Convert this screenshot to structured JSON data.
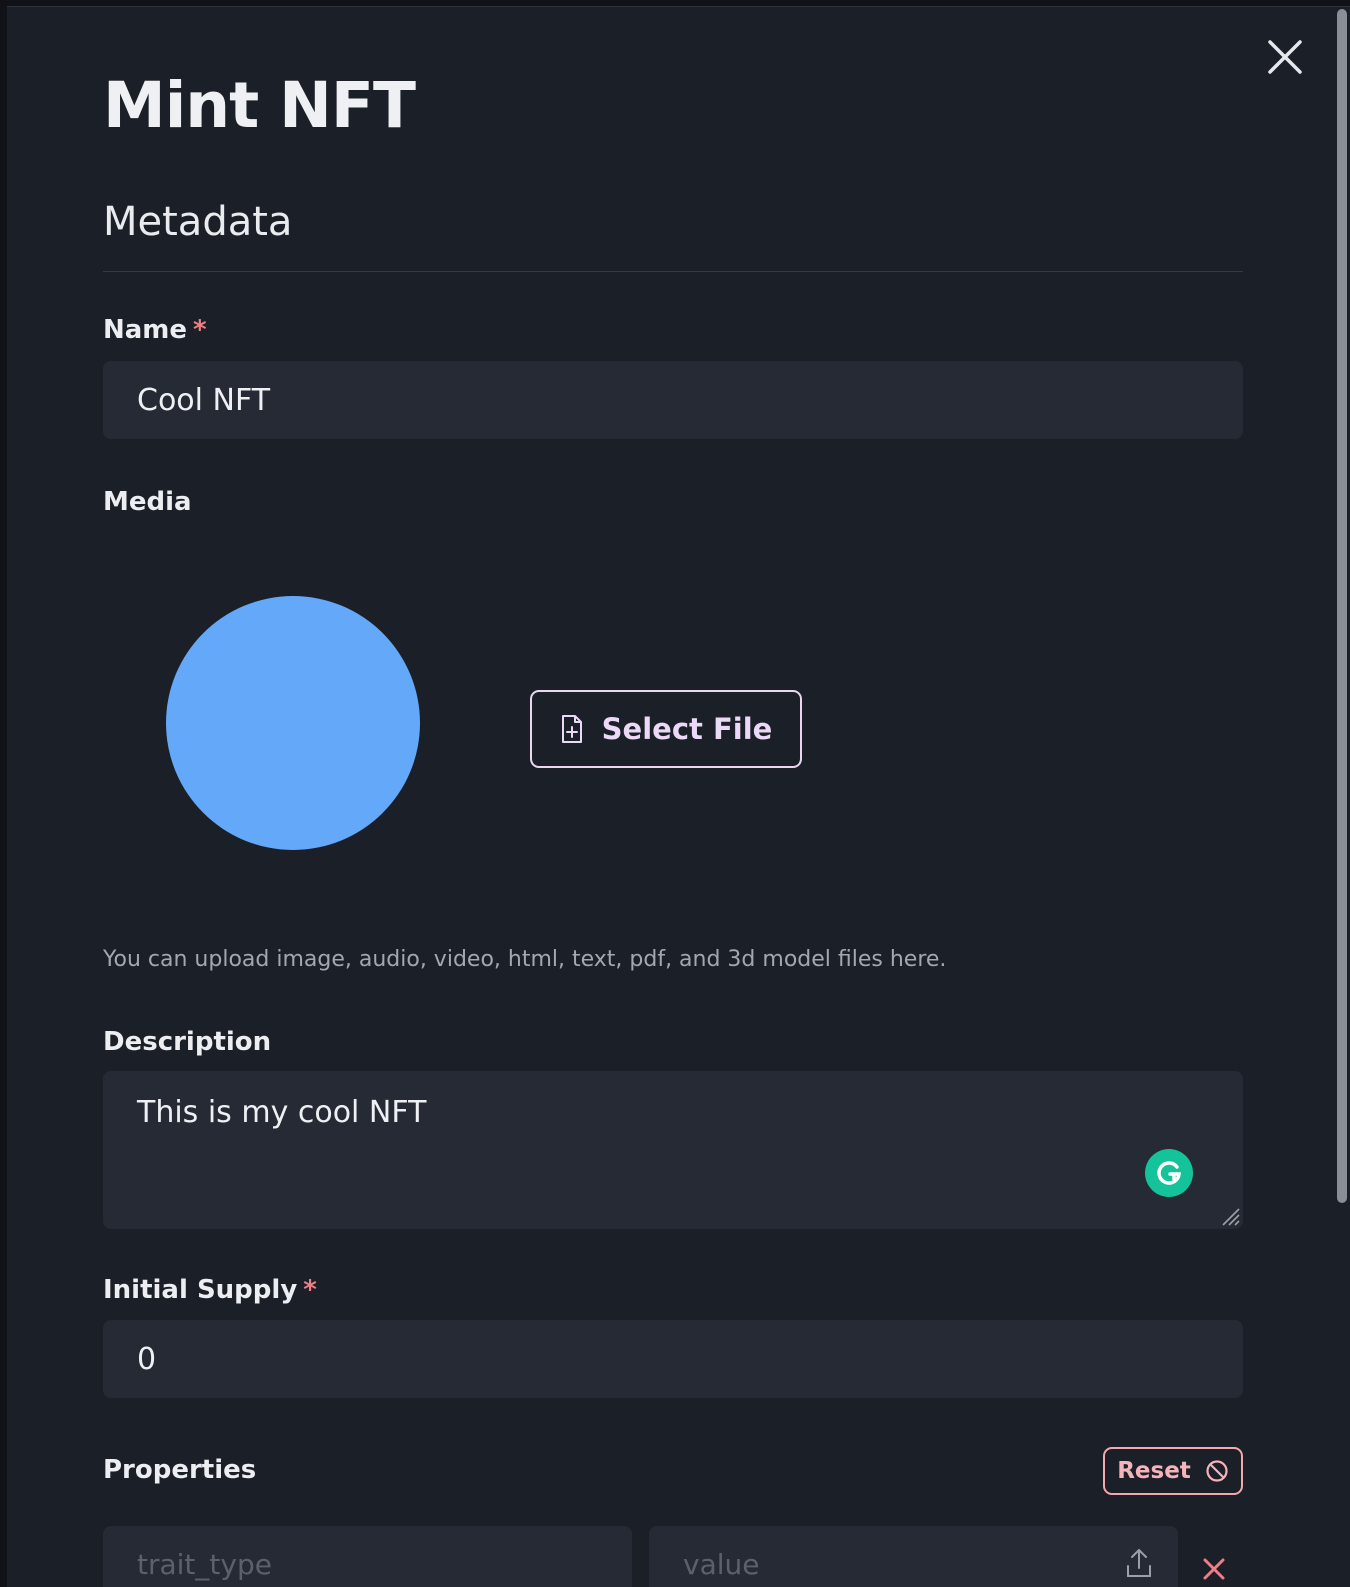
{
  "modal": {
    "title": "Mint NFT",
    "section_heading": "Metadata"
  },
  "fields": {
    "name": {
      "label": "Name",
      "required_mark": "*",
      "value": "Cool NFT"
    },
    "media": {
      "label": "Media",
      "select_file_label": "Select File",
      "helper_text": "You can upload image, audio, video, html, text, pdf, and 3d model files here.",
      "preview_color": "#63a8f9"
    },
    "description": {
      "label": "Description",
      "value": "This is my cool NFT"
    },
    "initial_supply": {
      "label": "Initial Supply",
      "required_mark": "*",
      "value": "0"
    },
    "properties": {
      "label": "Properties",
      "reset_label": "Reset",
      "rows": [
        {
          "trait_type_placeholder": "trait_type",
          "value_placeholder": "value"
        }
      ]
    }
  },
  "icons": {
    "close": "close-icon",
    "file_add": "file-plus-icon",
    "grammarly": "grammarly-icon",
    "reset": "ban-icon",
    "upload": "upload-icon",
    "remove": "remove-icon"
  },
  "colors": {
    "background": "#1b1f27",
    "input_background": "#262a34",
    "required": "#f07e86",
    "accent_button": "#ecd8f7",
    "reset_button": "#f5b4b9",
    "grammarly": "#15c39a"
  }
}
